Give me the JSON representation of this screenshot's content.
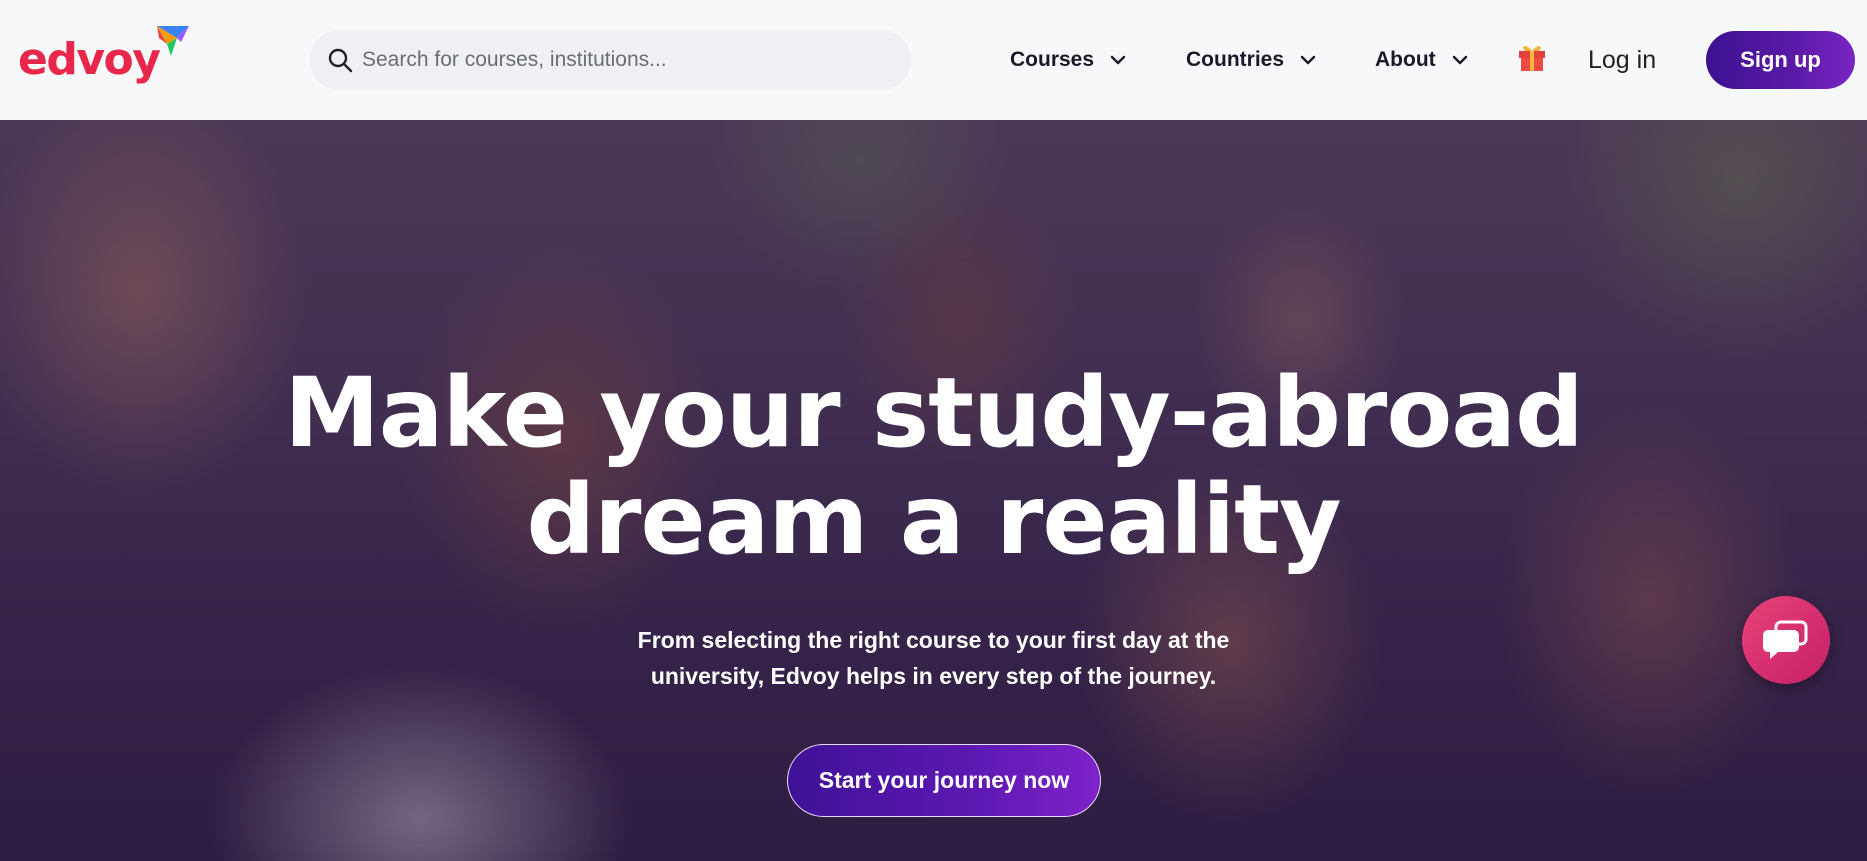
{
  "header": {
    "logo_text": "edvoy",
    "brand_color": "#e8274b",
    "search": {
      "placeholder": "Search for courses, institutions...",
      "value": ""
    },
    "nav": [
      {
        "label": "Courses"
      },
      {
        "label": "Countries"
      },
      {
        "label": "About"
      }
    ],
    "gift_icon": "gift-icon",
    "login_label": "Log in",
    "signup_label": "Sign up",
    "accent_color": "#4b1699"
  },
  "hero": {
    "title_line1": "Make your study-abroad",
    "title_line2": "dream a reality",
    "subtitle_line1": "From selecting the right course to your first day at the",
    "subtitle_line2": "university, Edvoy helps in every step of the journey.",
    "cta_label": "Start your journey now",
    "background": "group-of-smiling-students-photo"
  },
  "chat_widget": {
    "icon": "chat-bubble-icon",
    "color": "#e0396f"
  }
}
